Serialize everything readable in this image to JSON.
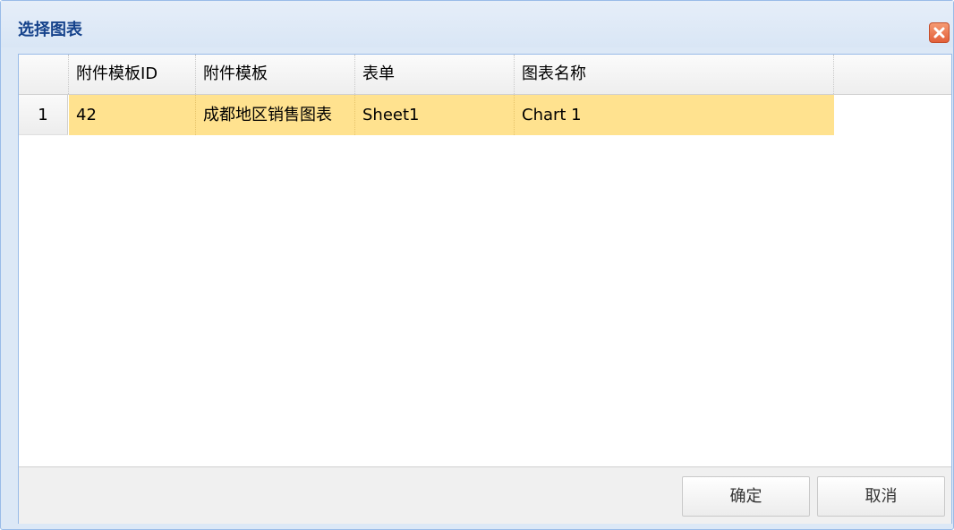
{
  "dialog": {
    "title": "选择图表",
    "close_icon": "close-icon"
  },
  "grid": {
    "columns": [
      "",
      "附件模板ID",
      "附件模板",
      "表单",
      "图表名称",
      ""
    ],
    "rows": [
      {
        "rownum": "1",
        "template_id": "42",
        "template": "成都地区销售图表",
        "sheet": "Sheet1",
        "chart_name": "Chart 1"
      }
    ],
    "selected_row_color": "#ffe28f"
  },
  "buttons": {
    "ok_label": "确定",
    "cancel_label": "取消"
  },
  "colors": {
    "title": "#15428b",
    "frame_border": "#99bbe8",
    "close_button": "#e3603a"
  }
}
